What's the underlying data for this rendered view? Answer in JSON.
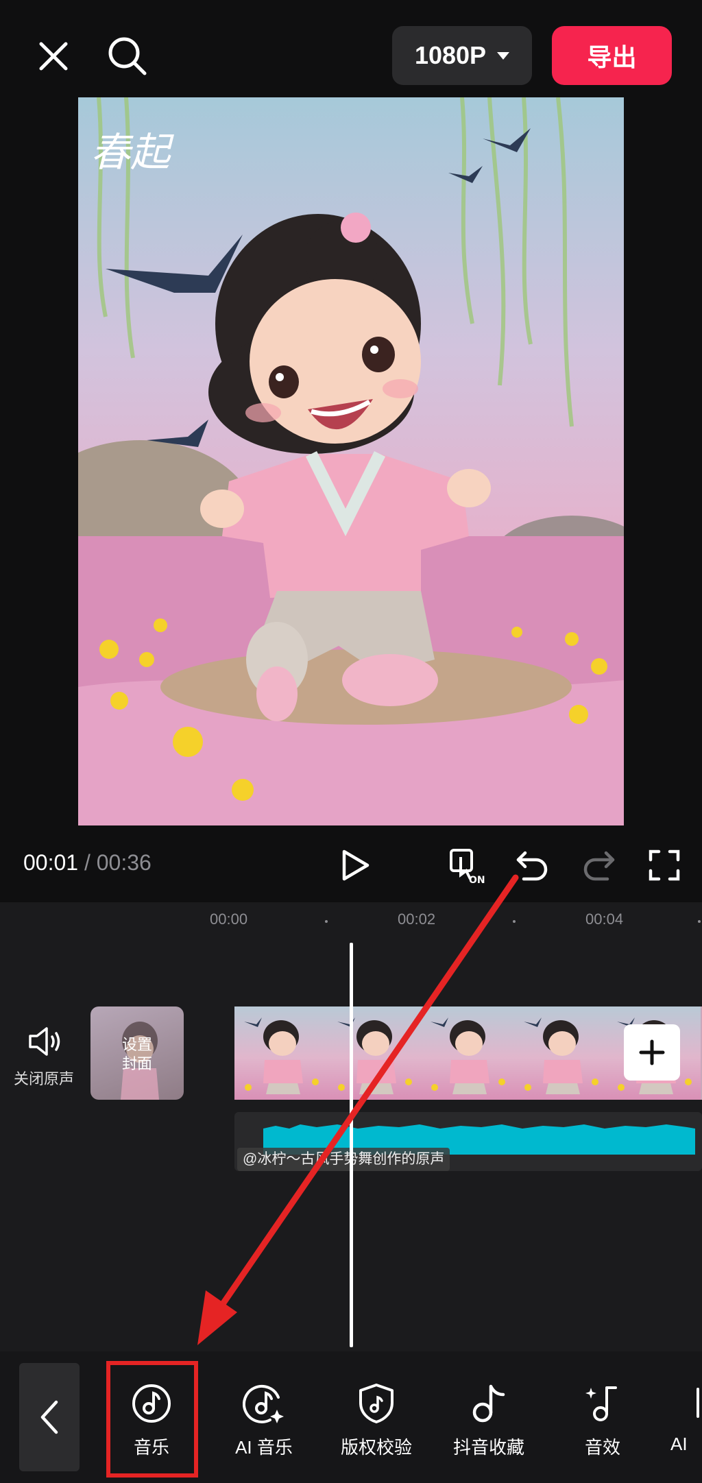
{
  "top_bar": {
    "resolution": "1080P",
    "export_label": "导出"
  },
  "preview": {
    "overlay_text": "春起"
  },
  "playback": {
    "current_time": "00:01",
    "separator": " / ",
    "total_time": "00:36"
  },
  "ruler": {
    "ticks": [
      "00:00",
      "00:02",
      "00:04"
    ]
  },
  "track": {
    "mute_label": "关闭原声",
    "cover_label": "设置\n封面",
    "audio_label": "@冰柠～古风手势舞创作的原声"
  },
  "toolbar": {
    "items": [
      {
        "label": "音乐",
        "icon": "music-icon"
      },
      {
        "label": "AI 音乐",
        "icon": "ai-music-icon"
      },
      {
        "label": "版权校验",
        "icon": "copyright-check-icon"
      },
      {
        "label": "抖音收藏",
        "icon": "douyin-favorites-icon"
      },
      {
        "label": "音效",
        "icon": "sound-effect-icon"
      },
      {
        "label": "AI",
        "icon": "ai-icon"
      }
    ]
  },
  "colors": {
    "accent": "#f6244e",
    "highlight": "#e52424",
    "audio_wave": "#00b9cf"
  }
}
